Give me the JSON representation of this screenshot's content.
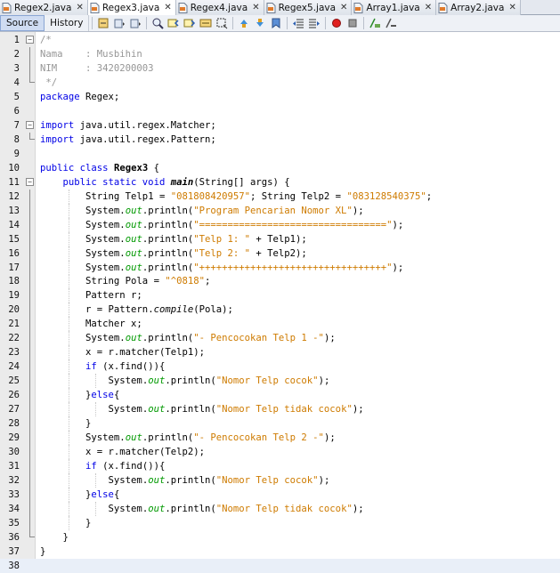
{
  "tabs": [
    {
      "label": "Regex2.java",
      "active": false
    },
    {
      "label": "Regex3.java",
      "active": true
    },
    {
      "label": "Regex4.java",
      "active": false
    },
    {
      "label": "Regex5.java",
      "active": false
    },
    {
      "label": "Array1.java",
      "active": false
    },
    {
      "label": "Array2.java",
      "active": false
    }
  ],
  "toolbar": {
    "source_label": "Source",
    "history_label": "History",
    "icons": [
      "last-edit-icon",
      "back-icon",
      "forward-icon",
      "find-selection-icon",
      "find-previous-icon",
      "find-next-icon",
      "toggle-highlight-icon",
      "toggle-rect-select-icon",
      "prev-bookmark-icon",
      "next-bookmark-icon",
      "toggle-bookmark-icon",
      "shift-left-icon",
      "shift-right-icon",
      "start-macro-icon",
      "stop-macro-icon",
      "comment-icon",
      "uncomment-icon"
    ]
  },
  "editor": {
    "line_numbers": [
      "1",
      "2",
      "3",
      "4",
      "5",
      "6",
      "7",
      "8",
      "9",
      "10",
      "11",
      "12",
      "13",
      "14",
      "15",
      "16",
      "17",
      "18",
      "19",
      "20",
      "21",
      "22",
      "23",
      "24",
      "25",
      "26",
      "27",
      "28",
      "29",
      "30",
      "31",
      "32",
      "33",
      "34",
      "35",
      "36",
      "37",
      "38"
    ],
    "current_line": 38,
    "colors": {
      "keyword": "#0000e6",
      "string": "#ce7b00",
      "comment": "#969696",
      "field": "#009900"
    },
    "code": {
      "l1": "/*",
      "l2": "Nama    : Musbihin",
      "l3": "NIM     : 3420200003",
      "l4": " */",
      "l5_kw": "package",
      "l5_rest": " Regex;",
      "l7_kw": "import",
      "l7_rest": " java.util.regex.Matcher;",
      "l8_kw": "import",
      "l8_rest": " java.util.regex.Pattern;",
      "l10_kw": "public class",
      "l10_cls": "Regex3",
      "l10_rest": " {",
      "l11_kw": "public static void",
      "l11_mth": "main",
      "l11_rest": "(String[] args) {",
      "l12_a": "String Telp1 = ",
      "l12_s1": "\"081808420957\"",
      "l12_b": "; String Telp2 = ",
      "l12_s2": "\"083128540375\"",
      "l12_c": ";",
      "println_prefix": "System.",
      "out": "out",
      "println_open": ".println(",
      "l13_str": "\"Program Pencarian Nomor XL\"",
      "l14_str": "\"=================================\"",
      "l15_str": "\"Telp 1: \"",
      "l15_rest": " + Telp1);",
      "l16_str": "\"Telp 2: \"",
      "l16_rest": " + Telp2);",
      "l17_str": "\"+++++++++++++++++++++++++++++++++\"",
      "close": ");",
      "l18_a": "String Pola = ",
      "l18_str": "\"^0818\"",
      "l18_b": ";",
      "l19": "Pattern r;",
      "l20_a": "r = Pattern.",
      "l20_m": "compile",
      "l20_b": "(Pola);",
      "l21": "Matcher x;",
      "l22_str": "\"- Pencocokan Telp 1 -\"",
      "l23": "x = r.matcher(Telp1);",
      "if_kw": "if",
      "if_rest": " (x.find()){",
      "l25_str": "\"Nomor Telp cocok\"",
      "else_a": "}",
      "else_kw": "else",
      "else_b": "{",
      "l27_str": "\"Nomor Telp tidak cocok\"",
      "brace": "}",
      "l30_str": "\"- Pencocokan Telp 2 -\"",
      "l31": "x = r.matcher(Telp2);",
      "l33_str": "\"Nomor Telp cocok\"",
      "l35_str": "\"Nomor Telp tidak cocok\""
    }
  }
}
